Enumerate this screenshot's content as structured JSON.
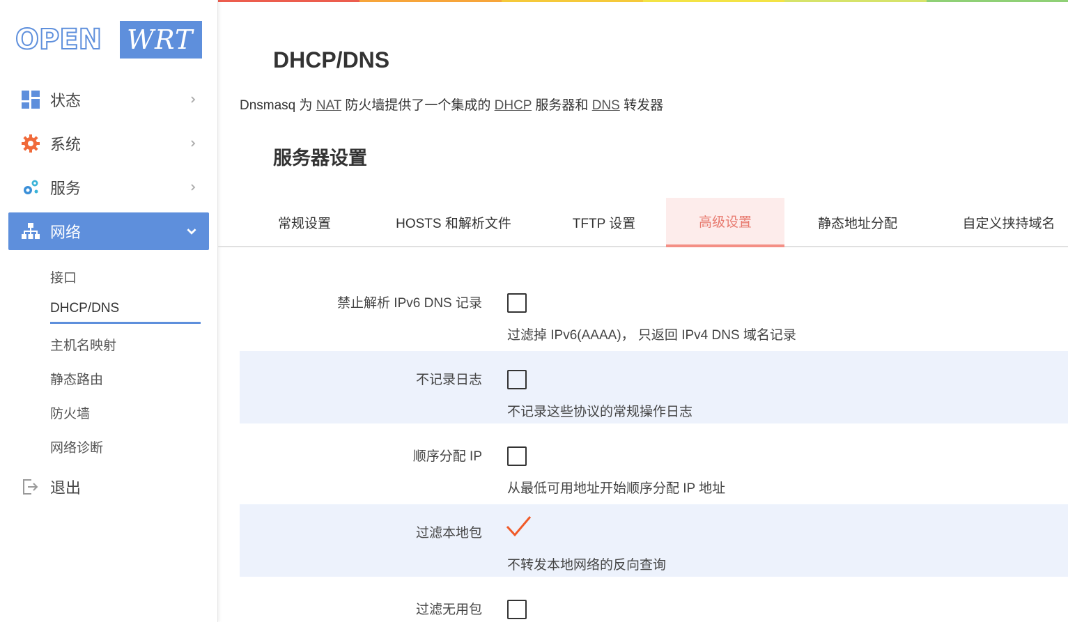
{
  "colors": {
    "accent": "#5e8fdc",
    "tab_active_text": "#e87a6f",
    "tab_active_bg": "#fdeceb",
    "row_shade": "#edf2fc",
    "checkmark": "#f05a28",
    "rainbow": [
      "#ec5d4e",
      "#f7a53a",
      "#f5c93a",
      "#f3e345",
      "#d6e36a",
      "#8fd076"
    ]
  },
  "logo": {
    "open": "OPEN",
    "wrt": "WRT"
  },
  "sidebar": {
    "menu": [
      {
        "label": "状态",
        "icon": "dashboard-icon"
      },
      {
        "label": "系统",
        "icon": "gear-icon"
      },
      {
        "label": "服务",
        "icon": "services-gears-icon"
      },
      {
        "label": "网络",
        "icon": "network-tree-icon"
      }
    ],
    "network_sub": [
      {
        "label": "接口"
      },
      {
        "label": "DHCP/DNS"
      },
      {
        "label": "主机名映射"
      },
      {
        "label": "静态路由"
      },
      {
        "label": "防火墙"
      },
      {
        "label": "网络诊断"
      }
    ],
    "logout": {
      "label": "退出",
      "icon": "logout-icon"
    }
  },
  "main": {
    "title": "DHCP/DNS",
    "desc": {
      "p1": "Dnsmasq 为 ",
      "nat": "NAT",
      "p2": " 防火墙提供了一个集成的 ",
      "dhcp": "DHCP",
      "p3": " 服务器和 ",
      "dns": "DNS",
      "p4": " 转发器"
    },
    "section_title": "服务器设置",
    "tabs": [
      {
        "label": "常规设置"
      },
      {
        "label": "HOSTS 和解析文件"
      },
      {
        "label": "TFTP 设置"
      },
      {
        "label": "高级设置"
      },
      {
        "label": "静态地址分配"
      },
      {
        "label": "自定义挟持域名"
      }
    ],
    "options": [
      {
        "label": "禁止解析 IPv6 DNS 记录",
        "help": "过滤掉 IPv6(AAAA)， 只返回 IPv4 DNS 域名记录",
        "checked": false
      },
      {
        "label": "不记录日志",
        "help": "不记录这些协议的常规操作日志",
        "checked": false
      },
      {
        "label": "顺序分配 IP",
        "help": "从最低可用地址开始顺序分配 IP 地址",
        "checked": false
      },
      {
        "label": "过滤本地包",
        "help": "不转发本地网络的反向查询",
        "checked": true
      },
      {
        "label": "过滤无用包",
        "help": "",
        "checked": false
      }
    ]
  }
}
